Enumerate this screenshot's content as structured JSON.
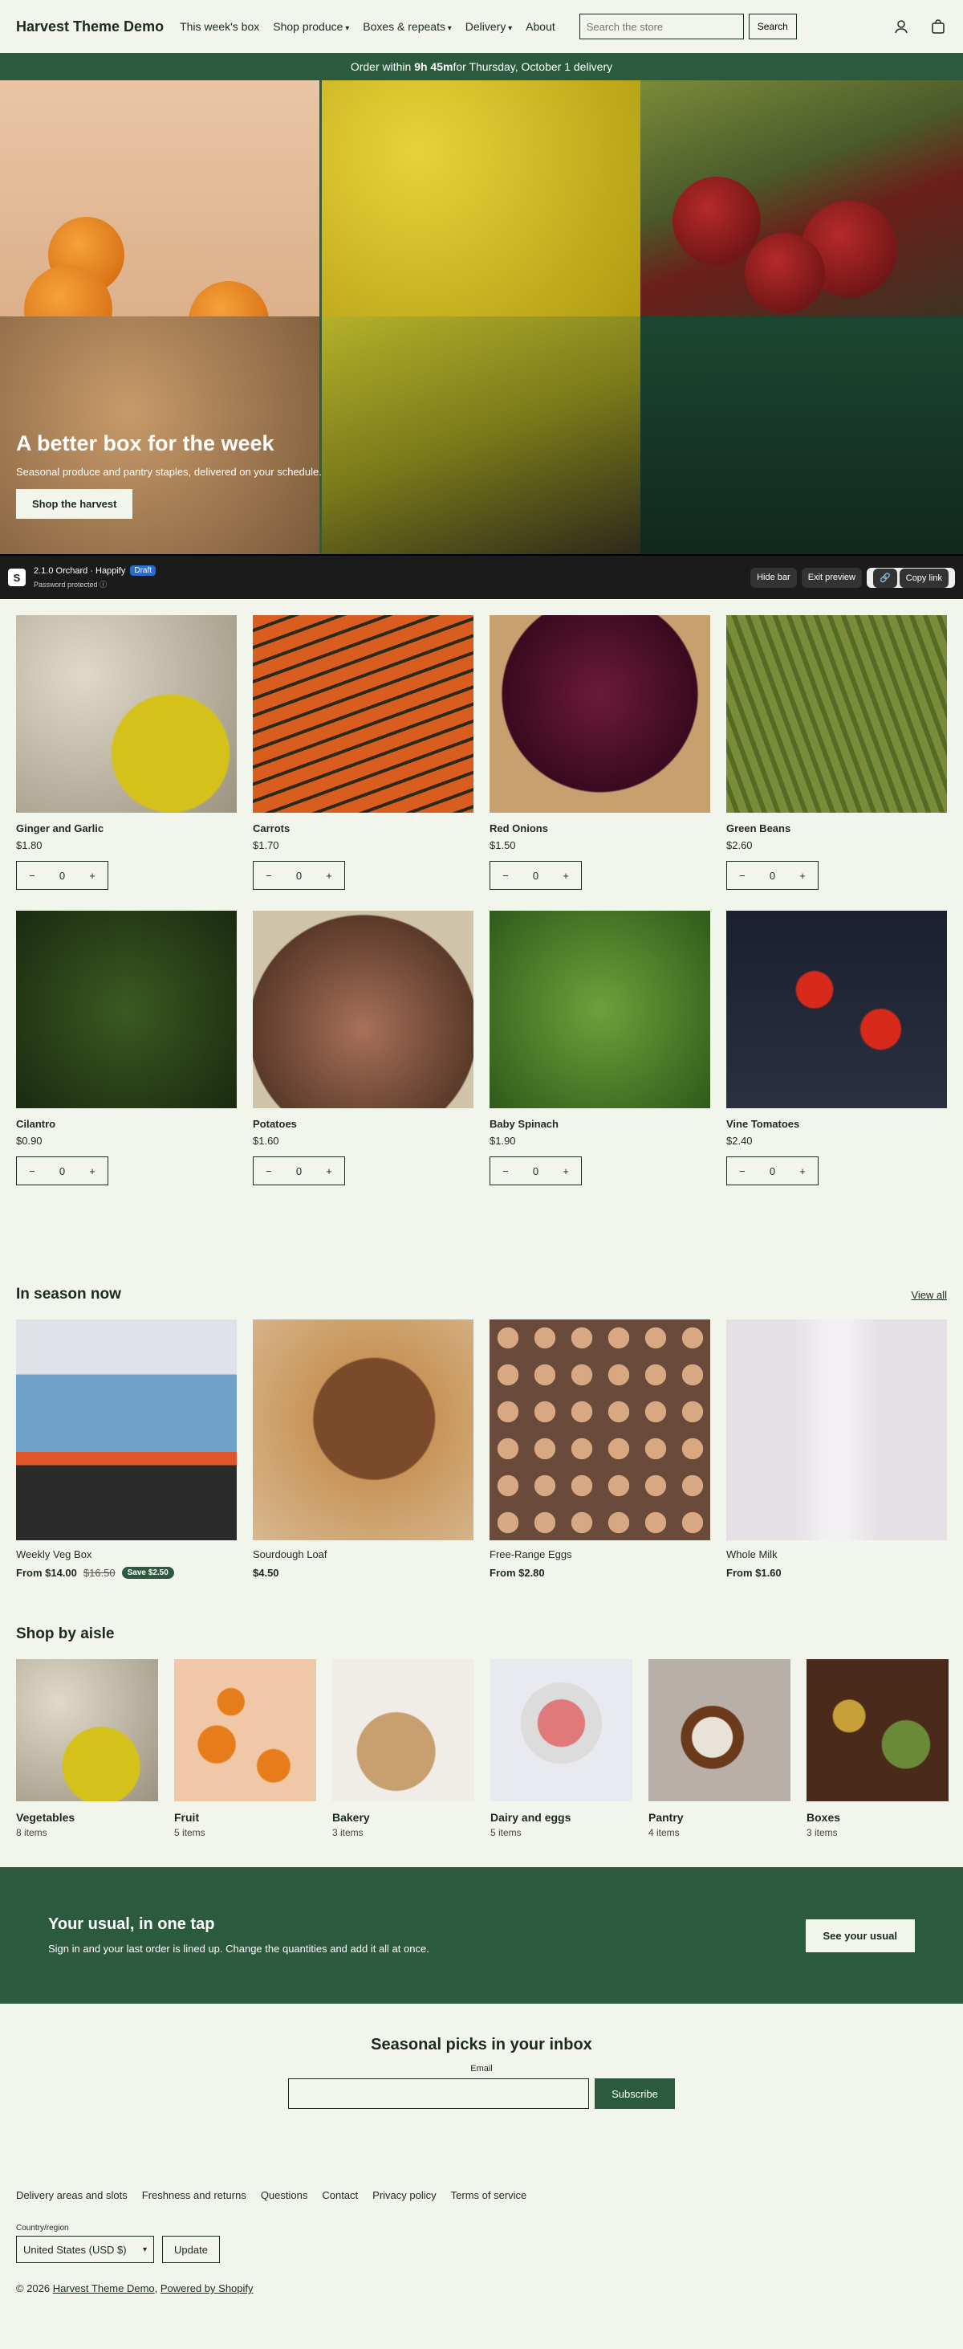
{
  "header": {
    "logo": "Harvest Theme Demo",
    "nav": [
      {
        "label": "This week's box",
        "dropdown": false
      },
      {
        "label": "Shop produce",
        "dropdown": true
      },
      {
        "label": "Boxes & repeats",
        "dropdown": true
      },
      {
        "label": "Delivery",
        "dropdown": true
      },
      {
        "label": "About",
        "dropdown": false
      }
    ],
    "search_placeholder": "Search the store",
    "search_button": "Search"
  },
  "announcement": {
    "prefix": "Order within ",
    "countdown": "9h 45m",
    "suffix": " for Thursday, October 1 delivery"
  },
  "hero": {
    "title": "A better box for the week",
    "subtitle": "Seasonal produce and pantry staples, delivered on your schedule.",
    "button": "Shop the harvest"
  },
  "admin_bar": {
    "name": "2.1.0 Orchard · Happify",
    "badge": "Draft",
    "status": "Password protected",
    "buttons": [
      "Hide bar",
      "Exit preview",
      "Copy link"
    ]
  },
  "products": [
    {
      "name": "Ginger and Garlic",
      "price": "$1.80",
      "qty": "0",
      "img": "img-garlic"
    },
    {
      "name": "Carrots",
      "price": "$1.70",
      "qty": "0",
      "img": "img-carrot"
    },
    {
      "name": "Red Onions",
      "price": "$1.50",
      "qty": "0",
      "img": "img-onion"
    },
    {
      "name": "Green Beans",
      "price": "$2.60",
      "qty": "0",
      "img": "img-beans"
    },
    {
      "name": "Cilantro",
      "price": "$0.90",
      "qty": "0",
      "img": "img-cilantro"
    },
    {
      "name": "Potatoes",
      "price": "$1.60",
      "qty": "0",
      "img": "img-potato"
    },
    {
      "name": "Baby Spinach",
      "price": "$1.90",
      "qty": "0",
      "img": "img-spinach"
    },
    {
      "name": "Vine Tomatoes",
      "price": "$2.40",
      "qty": "0",
      "img": "img-tomato"
    }
  ],
  "stepper": {
    "minus": "−",
    "plus": "+"
  },
  "season": {
    "title": "In season now",
    "view_all": "View all",
    "items": [
      {
        "name": "Weekly Veg Box",
        "price": "From $14.00",
        "compare": "$16.50",
        "badge": "Save $2.50",
        "img": "img-box"
      },
      {
        "name": "Sourdough Loaf",
        "price": "$4.50",
        "compare": "",
        "badge": "",
        "img": "img-loaf"
      },
      {
        "name": "Free-Range Eggs",
        "price": "From $2.80",
        "compare": "",
        "badge": "",
        "img": "img-eggs"
      },
      {
        "name": "Whole Milk",
        "price": "From $1.60",
        "compare": "",
        "badge": "",
        "img": "img-milk"
      }
    ]
  },
  "aisles": {
    "title": "Shop by aisle",
    "items": [
      {
        "name": "Vegetables",
        "count": "8 items",
        "img": "img-veg"
      },
      {
        "name": "Fruit",
        "count": "5 items",
        "img": "img-fruit"
      },
      {
        "name": "Bakery",
        "count": "3 items",
        "img": "img-bakery"
      },
      {
        "name": "Dairy and eggs",
        "count": "5 items",
        "img": "img-dairy"
      },
      {
        "name": "Pantry",
        "count": "4 items",
        "img": "img-pantry"
      },
      {
        "name": "Boxes",
        "count": "3 items",
        "img": "img-boxes"
      }
    ]
  },
  "cta": {
    "title": "Your usual, in one tap",
    "text": "Sign in and your last order is lined up. Change the quantities and add it all at once.",
    "button": "See your usual"
  },
  "newsletter": {
    "title": "Seasonal picks in your inbox",
    "label": "Email",
    "button": "Subscribe"
  },
  "footer": {
    "links": [
      "Delivery areas and slots",
      "Freshness and returns",
      "Questions",
      "Contact",
      "Privacy policy",
      "Terms of service"
    ],
    "country_label": "Country/region",
    "country_value": "United States (USD $)",
    "update": "Update",
    "copyright_prefix": "© 2026 ",
    "store_link": "Harvest Theme Demo",
    "powered": "Powered by Shopify"
  },
  "colors": {
    "brand": "#2b5a3f",
    "background": "#f2f5ec",
    "text": "#1a2a1f"
  }
}
